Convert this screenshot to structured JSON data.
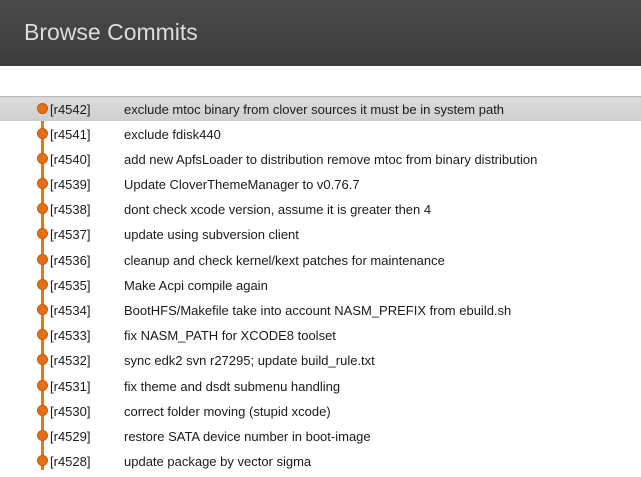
{
  "header": {
    "title": "Browse Commits"
  },
  "colors": {
    "header_bg": "#3f3f3f",
    "timeline_accent": "#e56f13",
    "selected_row_bg": "#d5d5d5"
  },
  "commits": [
    {
      "rev": "[r4542]",
      "message": "exclude mtoc binary from clover sources  it must be in system path",
      "selected": true
    },
    {
      "rev": "[r4541]",
      "message": "exclude fdisk440",
      "selected": false
    },
    {
      "rev": "[r4540]",
      "message": "add new ApfsLoader to distribution remove mtoc from binary distribution",
      "selected": false
    },
    {
      "rev": "[r4539]",
      "message": "Update CloverThemeManager to v0.76.7",
      "selected": false
    },
    {
      "rev": "[r4538]",
      "message": "dont check xcode version, assume it is greater then 4",
      "selected": false
    },
    {
      "rev": "[r4537]",
      "message": "update using subversion client",
      "selected": false
    },
    {
      "rev": "[r4536]",
      "message": "cleanup and check kernel/kext patches for maintenance",
      "selected": false
    },
    {
      "rev": "[r4535]",
      "message": "Make Acpi compile again",
      "selected": false
    },
    {
      "rev": "[r4534]",
      "message": "BootHFS/Makefile take into account NASM_PREFIX from ebuild.sh",
      "selected": false
    },
    {
      "rev": "[r4533]",
      "message": "fix NASM_PATH for XCODE8 toolset",
      "selected": false
    },
    {
      "rev": "[r4532]",
      "message": "sync edk2 svn r27295; update build_rule.txt",
      "selected": false
    },
    {
      "rev": "[r4531]",
      "message": "fix theme and dsdt submenu handling",
      "selected": false
    },
    {
      "rev": "[r4530]",
      "message": "correct folder moving (stupid xcode)",
      "selected": false
    },
    {
      "rev": "[r4529]",
      "message": "restore SATA device number in boot-image",
      "selected": false
    },
    {
      "rev": "[r4528]",
      "message": "update package by vector sigma",
      "selected": false
    }
  ]
}
